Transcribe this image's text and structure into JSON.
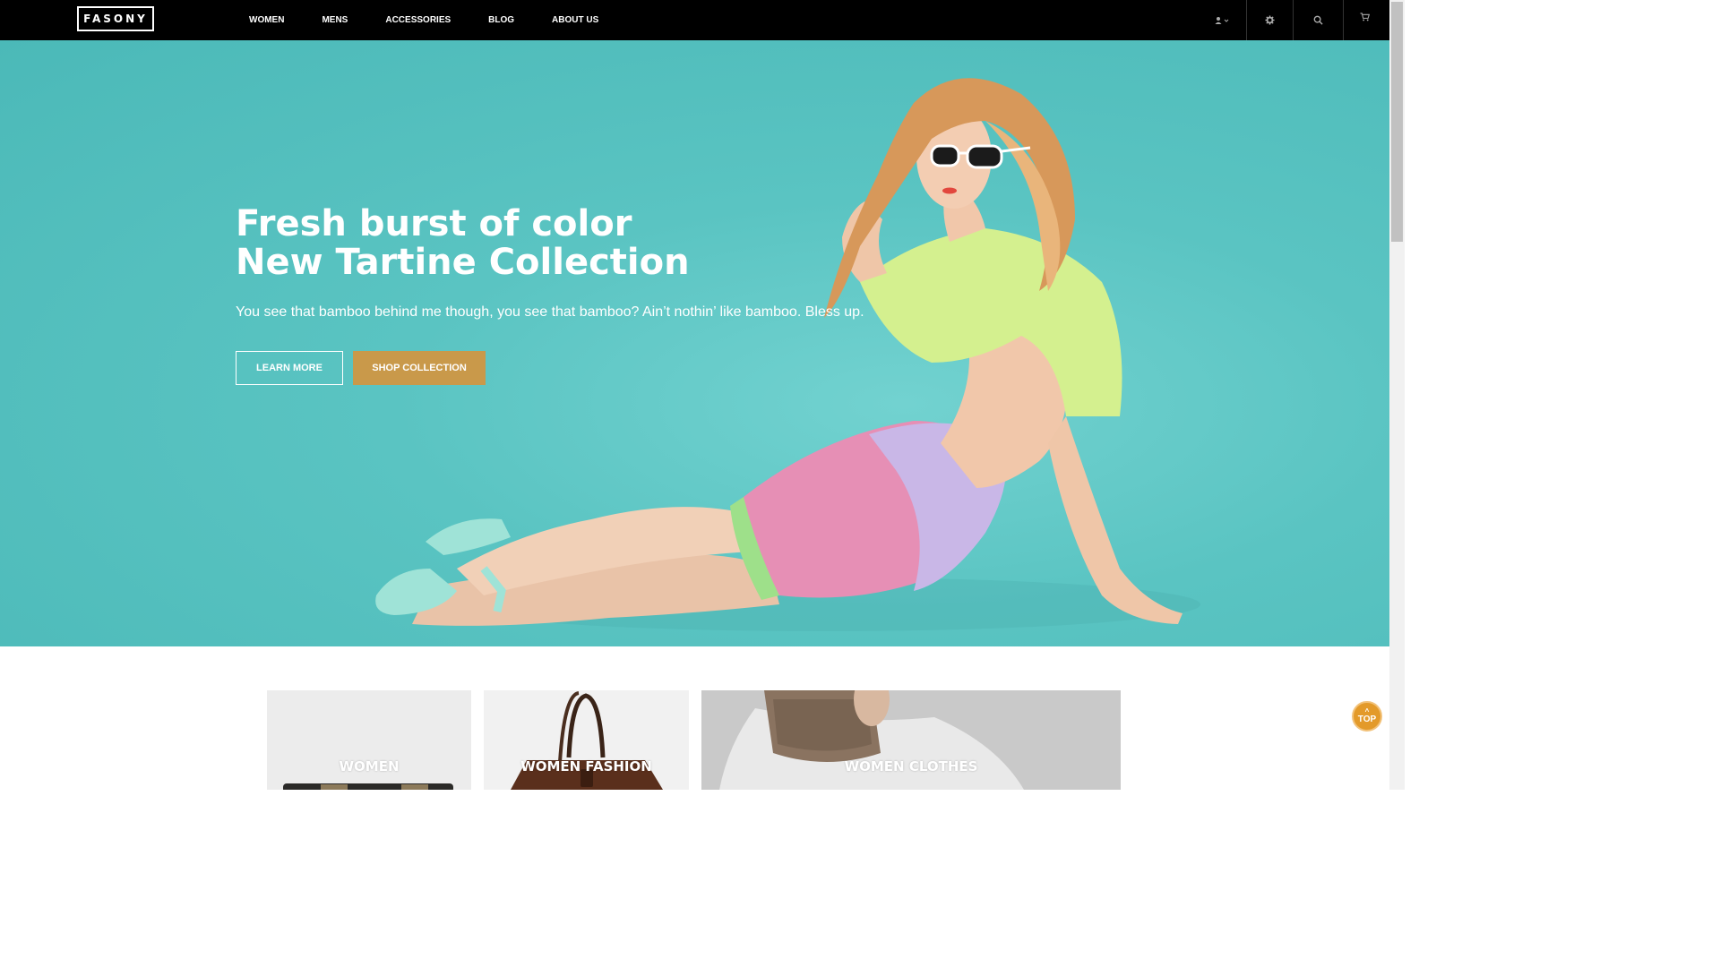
{
  "header": {
    "logo": "FASONY",
    "nav": [
      "WOMEN",
      "MENS",
      "ACCESSORIES",
      "BLOG",
      "ABOUT US"
    ],
    "icons": [
      "user-icon",
      "gear-icon",
      "search-icon",
      "cart-icon"
    ]
  },
  "hero": {
    "title_line1": "Fresh burst of color",
    "title_line2": "New Tartine Collection",
    "subtitle": "You see that bamboo behind me though, you see that bamboo? Ain’t nothin’ like bamboo. Bless up.",
    "learn_more": "LEARN MORE",
    "shop_collection": "SHOP COLLECTION",
    "background_color": "#5ac4c2",
    "accent_color": "#c9994a"
  },
  "categories": [
    {
      "label": "WOMEN"
    },
    {
      "label": "WOMEN FASHION"
    },
    {
      "label": "WOMEN CLOTHES"
    }
  ],
  "top_button": {
    "label": "TOP"
  }
}
